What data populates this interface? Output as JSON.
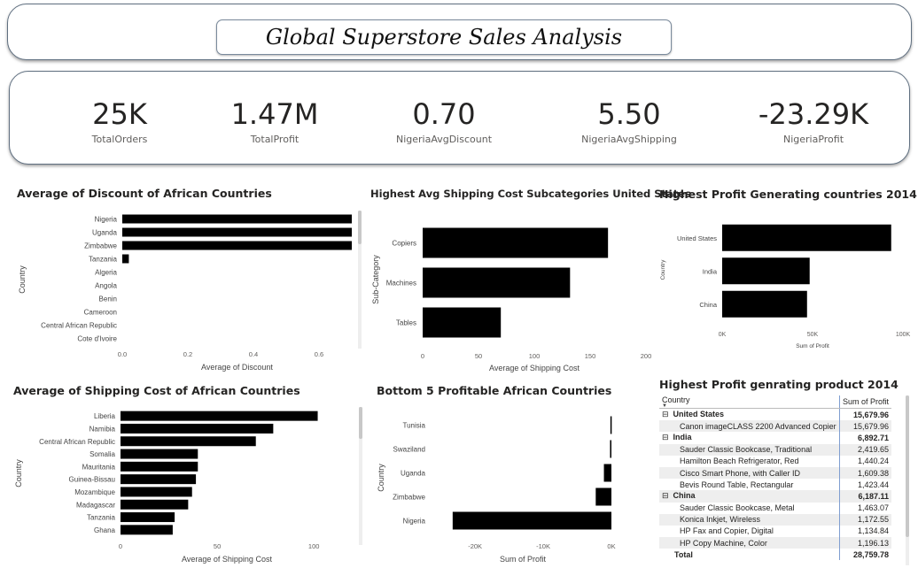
{
  "title": "Global Superstore Sales Analysis",
  "kpis": [
    {
      "value": "25K",
      "label": "TotalOrders"
    },
    {
      "value": "1.47M",
      "label": "TotalProfit"
    },
    {
      "value": "0.70",
      "label": "NigeriaAvgDiscount"
    },
    {
      "value": "5.50",
      "label": "NigeriaAvgShipping"
    },
    {
      "value": "-23.29K",
      "label": "NigeriaProfit"
    }
  ],
  "chart_data": [
    {
      "type": "bar",
      "orientation": "horizontal",
      "title": "Average of Discount of African Countries",
      "xlabel": "Average of Discount",
      "ylabel": "Country",
      "categories": [
        "Nigeria",
        "Uganda",
        "Zimbabwe",
        "Tanzania",
        "Algeria",
        "Angola",
        "Benin",
        "Cameroon",
        "Central African Republic",
        "Cote d'Ivoire"
      ],
      "values": [
        0.7,
        0.7,
        0.7,
        0.02,
        0,
        0,
        0,
        0,
        0,
        0
      ],
      "xlim": [
        0,
        0.7
      ],
      "xticks": [
        0.0,
        0.2,
        0.4,
        0.6
      ],
      "xtick_labels": [
        "0.0",
        "0.2",
        "0.4",
        "0.6"
      ],
      "grid": false
    },
    {
      "type": "bar",
      "orientation": "horizontal",
      "title": "Highest Avg Shipping Cost Subcategories United States",
      "xlabel": "Average of Shipping Cost",
      "ylabel": "Sub-Category",
      "categories": [
        "Copiers",
        "Machines",
        "Tables"
      ],
      "values": [
        166,
        132,
        70
      ],
      "xlim": [
        0,
        200
      ],
      "xticks": [
        0,
        50,
        100,
        150,
        200
      ],
      "xtick_labels": [
        "0",
        "50",
        "100",
        "150",
        "200"
      ],
      "grid": false
    },
    {
      "type": "bar",
      "orientation": "horizontal",
      "title": "Highest Profit Generating countries 2014",
      "xlabel": "Sum of Profit",
      "ylabel": "Country",
      "categories": [
        "United States",
        "India",
        "China"
      ],
      "values": [
        93507,
        48400,
        46950
      ],
      "xlim": [
        0,
        100000
      ],
      "xticks": [
        0,
        50000,
        100000
      ],
      "xtick_labels": [
        "0K",
        "50K",
        "100K"
      ],
      "grid": false
    },
    {
      "type": "bar",
      "orientation": "horizontal",
      "title": "Average of Shipping Cost of African Countries",
      "xlabel": "Average of Shipping Cost",
      "ylabel": "Country",
      "categories": [
        "Liberia",
        "Namibia",
        "Central African Republic",
        "Somalia",
        "Mauritania",
        "Guinea-Bissau",
        "Mozambique",
        "Madagascar",
        "Tanzania",
        "Ghana"
      ],
      "values": [
        102,
        79,
        70,
        40,
        40,
        39,
        37,
        35,
        28,
        27
      ],
      "xlim": [
        0,
        110
      ],
      "xticks": [
        0,
        50,
        100
      ],
      "xtick_labels": [
        "0",
        "50",
        "100"
      ],
      "grid": false
    },
    {
      "type": "bar",
      "orientation": "horizontal",
      "title": "Bottom 5 Profitable African Countries",
      "xlabel": "Sum of Profit",
      "ylabel": "Country",
      "categories": [
        "Tunisia",
        "Swaziland",
        "Uganda",
        "Zimbabwe",
        "Nigeria"
      ],
      "values": [
        -150,
        -200,
        -1100,
        -2300,
        -23290
      ],
      "xlim": [
        -26000,
        0
      ],
      "xticks": [
        -20000,
        -10000,
        0
      ],
      "xtick_labels": [
        "-20K",
        "-10K",
        "0K"
      ],
      "grid": false
    }
  ],
  "matrix": {
    "title": "Highest Profit genrating product 2014",
    "columns": [
      "Country",
      "Sum of Profit"
    ],
    "groups": [
      {
        "name": "United States",
        "total": "15,679.96",
        "rows": [
          {
            "product": "Canon imageCLASS 2200 Advanced Copier",
            "value": "15,679.96"
          }
        ]
      },
      {
        "name": "India",
        "total": "6,892.71",
        "rows": [
          {
            "product": "Sauder Classic Bookcase, Traditional",
            "value": "2,419.65"
          },
          {
            "product": "Hamilton Beach Refrigerator, Red",
            "value": "1,440.24"
          },
          {
            "product": "Cisco Smart Phone, with Caller ID",
            "value": "1,609.38"
          },
          {
            "product": "Bevis Round Table, Rectangular",
            "value": "1,423.44"
          }
        ]
      },
      {
        "name": "China",
        "total": "6,187.11",
        "rows": [
          {
            "product": "Sauder Classic Bookcase, Metal",
            "value": "1,463.07"
          },
          {
            "product": "Konica Inkjet, Wireless",
            "value": "1,172.55"
          },
          {
            "product": "HP Fax and Copier, Digital",
            "value": "1,134.84"
          },
          {
            "product": "HP Copy Machine, Color",
            "value": "1,196.13"
          }
        ]
      }
    ],
    "total_label": "Total",
    "total_value": "28,759.78",
    "expander_symbol": "⊟"
  }
}
